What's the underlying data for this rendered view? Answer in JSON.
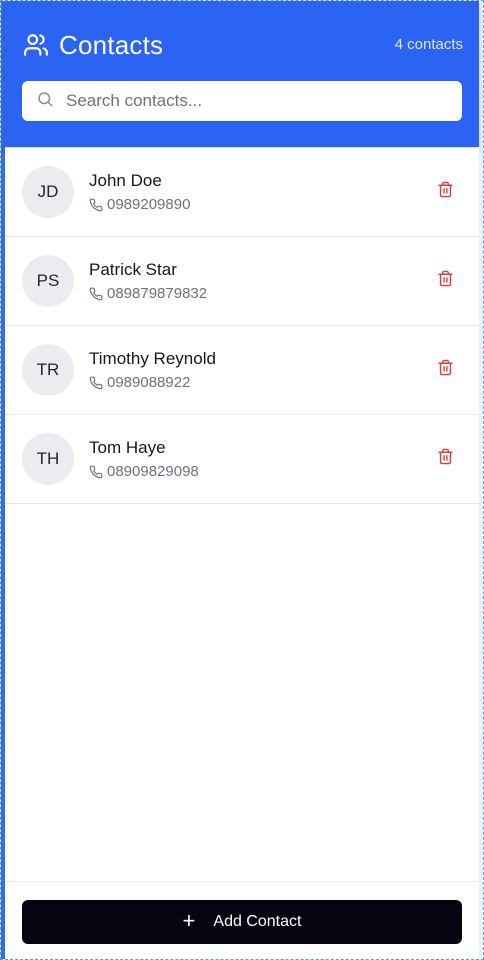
{
  "header": {
    "title": "Contacts",
    "count_label": "4 contacts",
    "icon": "users-icon",
    "bg_color": "#2b63f2"
  },
  "search": {
    "placeholder": "Search contacts...",
    "value": "",
    "icon": "search-icon"
  },
  "contacts": [
    {
      "initials": "JD",
      "name": "John Doe",
      "phone": "0989209890"
    },
    {
      "initials": "PS",
      "name": "Patrick Star",
      "phone": "089879879832"
    },
    {
      "initials": "TR",
      "name": "Timothy Reynold",
      "phone": "0989088922"
    },
    {
      "initials": "TH",
      "name": "Tom Haye",
      "phone": "08909829098"
    }
  ],
  "row_icons": {
    "phone": "phone-icon",
    "delete": "trash-icon",
    "delete_color": "#e03b3b"
  },
  "footer": {
    "add_button_label": "Add Contact",
    "add_button_icon": "plus-icon",
    "button_color": "#050511"
  }
}
